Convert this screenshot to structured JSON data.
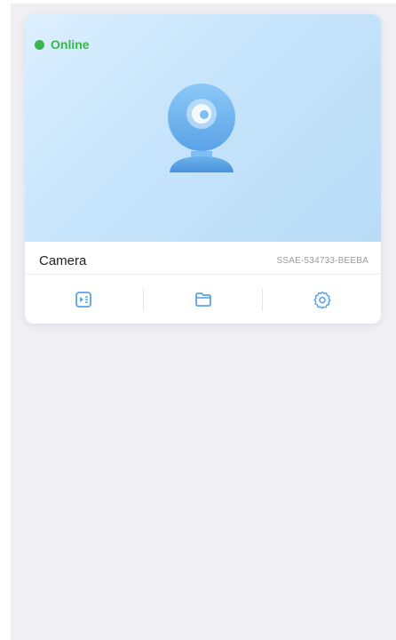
{
  "device": {
    "status": "Online",
    "name": "Camera",
    "id": "SSAE-534733-BEEBA"
  },
  "icons": {
    "status": "status-dot-icon",
    "camera": "ptz-camera-icon",
    "playback": "playback-icon",
    "cloud": "cloud-storage-icon",
    "settings": "gear-icon"
  },
  "colors": {
    "online": "#3cb54a",
    "accent": "#5aa3e6",
    "preview_top": "#dcefff",
    "preview_bottom": "#b9dcf7"
  }
}
